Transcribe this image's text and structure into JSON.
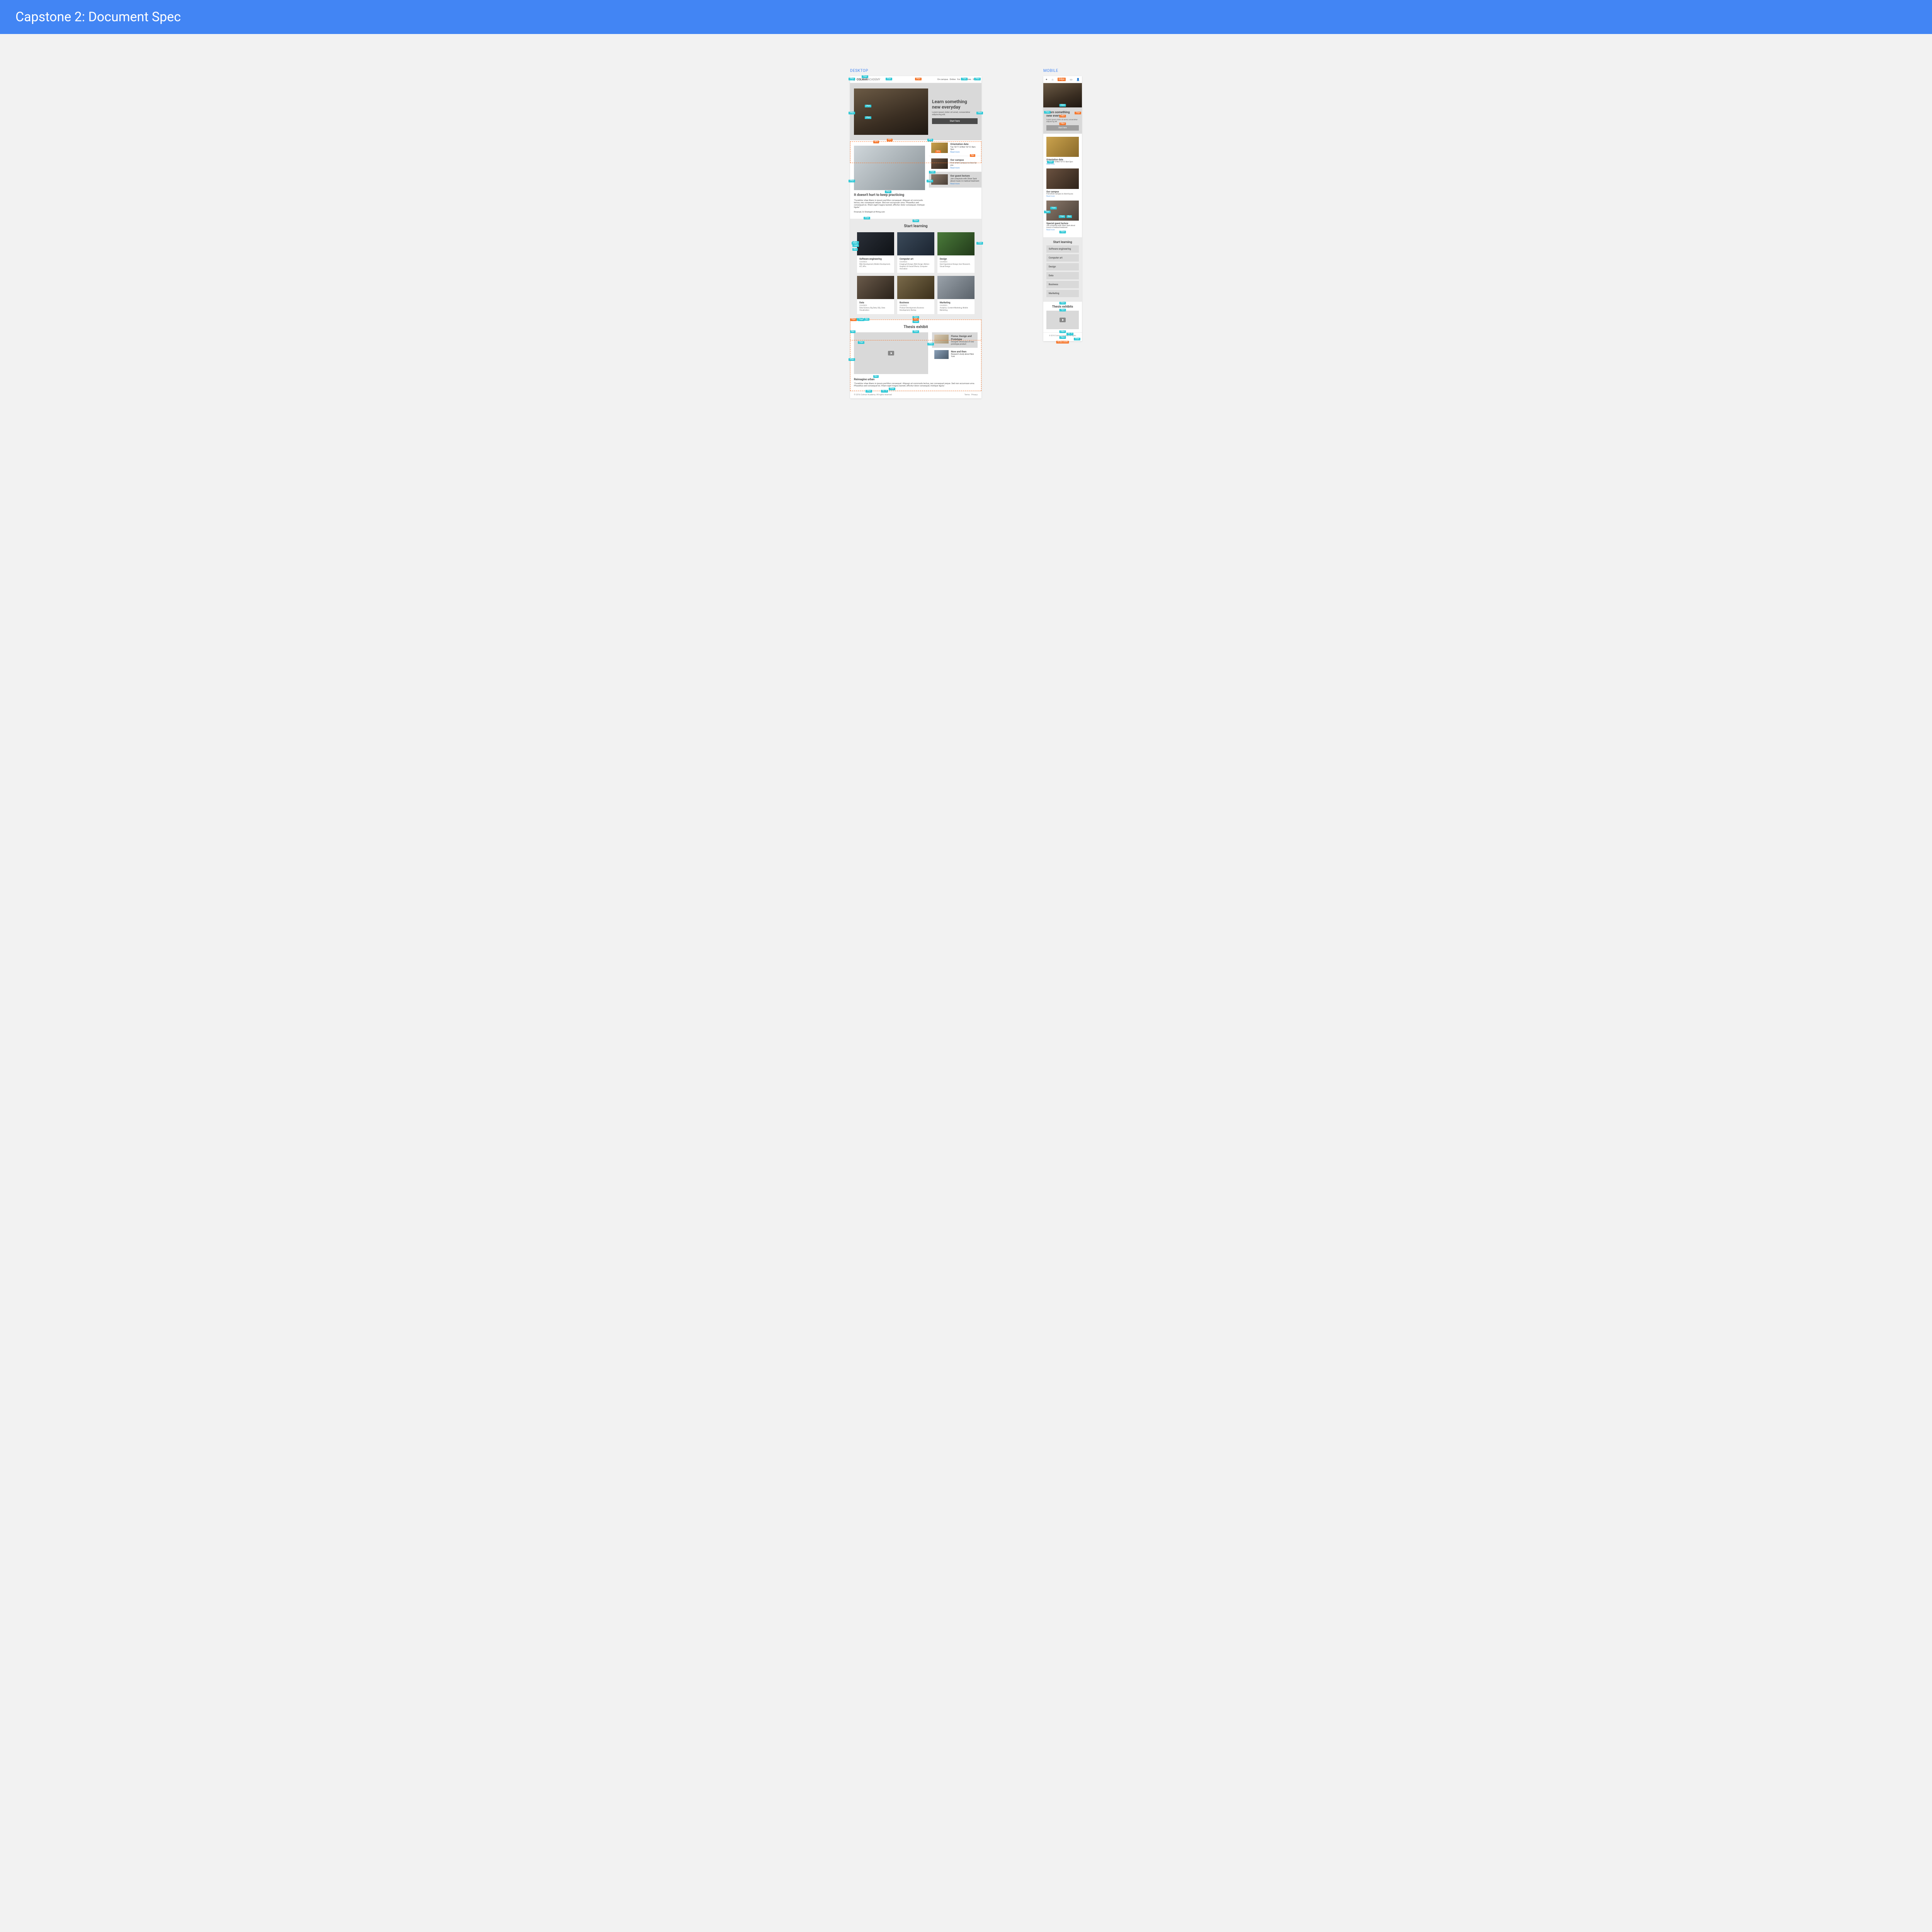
{
  "page_title": "Capstone 2: Document Spec",
  "labels": {
    "desktop": "DESKTOP",
    "mobile": "MOBILE"
  },
  "brand": {
    "bold": "COLMAR",
    "light": "ACADEMY"
  },
  "nav": [
    "On campus",
    "Online",
    "For companies",
    "Sign in"
  ],
  "hero": {
    "title_l1": "Learn something",
    "title_l2": "new everyday",
    "body": "Lorem ipsum dolor sit amet, consectetur adipiscing elit.",
    "cta": "Start here"
  },
  "practice": {
    "title": "It doesn't hurt to keep practicing",
    "quote": "\"Curabitur vitae libero in ipsum porttitor consequat. Aliquam et commodo lectus, nec consequat neque. Sed non accumsan urna. Phasellus sed consequat ex. Etiam eget magna laoreet, efficitur dolor consequat, tristique ligula.\"",
    "attrib": "Emanuel, Sr Strategist at Hiring.com"
  },
  "info": [
    {
      "title": "Orientation date",
      "body": "Tue 10/11 & Wed 10/12: 8am-3pm",
      "link": "Read more"
    },
    {
      "title": "Our campus",
      "body": "Find which campus is close by you",
      "link": "Read more"
    },
    {
      "title": "Our guest lecture",
      "body": "Join a keynote with Oliver Sack about music in medical treatment",
      "link": "Read more"
    }
  ],
  "info_mobile_guest_title": "Special guest lecture",
  "learning_title": "Start learning",
  "courses_label": "COURSES",
  "courses": [
    {
      "title": "Software engineering",
      "desc": "Web Development, Mobile Development, iOT, APIs"
    },
    {
      "title": "Computer art",
      "desc": "Imaging & Design, Web Design, Motion Graphics & Visual Effects, Computer Animation"
    },
    {
      "title": "Design",
      "desc": "User Experience Design, User Research, Visual Design"
    },
    {
      "title": "Data",
      "desc": "Data Science, Big Data, SQL, Data Visualization"
    },
    {
      "title": "Business",
      "desc": "Product Development, Business Development, Startup"
    },
    {
      "title": "Marketing",
      "desc": "Analytics, Content Marketing, Mobile Marketing"
    }
  ],
  "thesis_title": "Thesis exhibit",
  "thesis_title_mobile": "Thesis exhibits",
  "thesis_main": {
    "title": "Reimagine urban",
    "body": "\"Curabitur vitae libero in ipsum porttitor consequat. Aliquam et commodo lectus, nec consequat neque. Sed non accumsan urna. Phasellus sed consequat ex. Etiam eget magna laoreet, efficitur dolor consequat, tristique ligula.\""
  },
  "thesis_side": [
    {
      "title": "Fisma: Design and Prototype",
      "body": "Designer showcase of new prototype product"
    },
    {
      "title": "Now and then",
      "body": "Research study about New York"
    }
  ],
  "footer": {
    "copyright": "© 2016 Colmar Academy. All rights reserved",
    "links": [
      "Terms",
      "Privacy"
    ]
  },
  "ann": {
    "h64": "64px",
    "p32": "32px",
    "p24": "24px",
    "p16": "16px",
    "p8": "8px",
    "w60": "60%",
    "w40": "40%",
    "w35": "35%",
    "w423": "423px width",
    "a16x9": "16 : 9"
  }
}
